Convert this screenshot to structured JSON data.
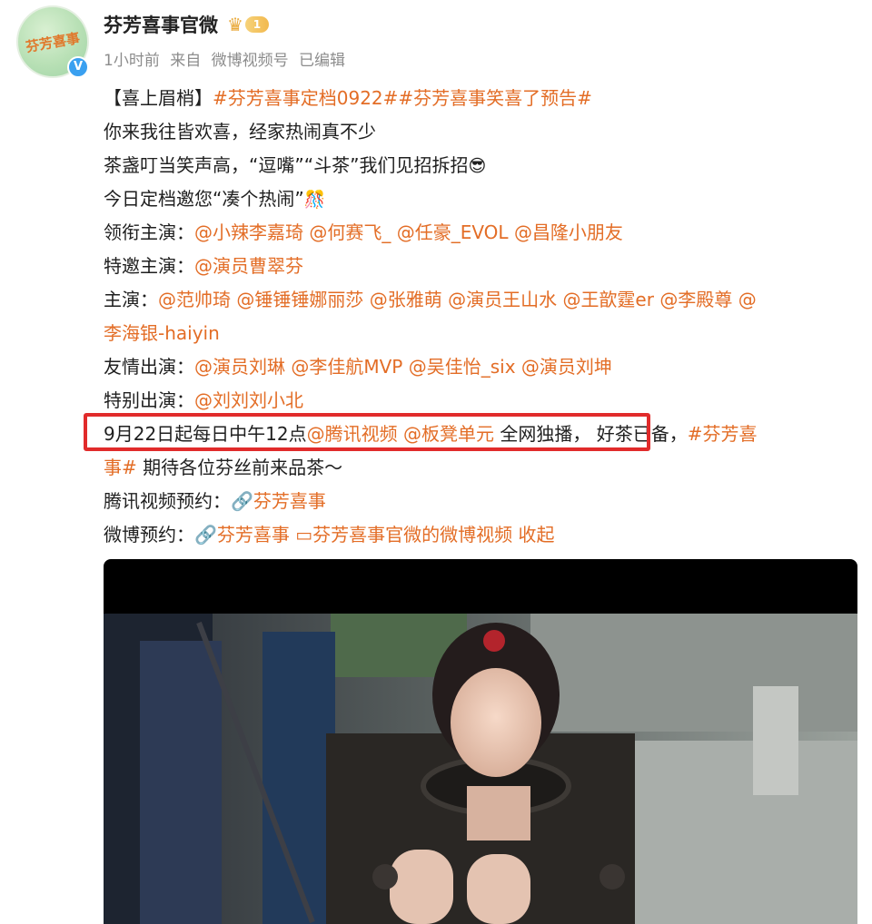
{
  "header": {
    "avatar_text": "芬芳喜事",
    "account_name": "芬芳喜事官微",
    "level_badge": "1",
    "verified_mark": "V",
    "meta": [
      "1小时前",
      "来自",
      "微博视频号",
      "已编辑"
    ]
  },
  "post": {
    "line1": {
      "prefix": "【喜上眉梢】",
      "tag1": "#芬芳喜事定档0922#",
      "tag2": "#芬芳喜事笑喜了预告#"
    },
    "line2": "你来我往皆欢喜，经家热闹真不少",
    "line3": {
      "text": "茶盏叮当笑声高，“逗嘴”“斗茶”我们见招拆招",
      "emoji": "😎"
    },
    "line4": {
      "text": "今日定档邀您“凑个热闹”",
      "emoji": "🎊"
    },
    "lead_actors": {
      "label": "领衔主演：",
      "mentions": [
        "@小辣李嘉琦",
        "@何赛飞_",
        "@任豪_EVOL",
        "@昌隆小朋友"
      ]
    },
    "special_guest": {
      "label": "特邀主演：",
      "mentions": [
        "@演员曹翠芬"
      ]
    },
    "main_cast": {
      "label": "主演：",
      "mentions": [
        "@范帅琦",
        "@锤锤锤娜丽莎",
        "@张雅萌",
        "@演员王山水",
        "@王歆霆er",
        "@李殿尊",
        "@"
      ],
      "cont": "李海银-haiyin"
    },
    "friendship": {
      "label": "友情出演：",
      "mentions": [
        "@演员刘琳",
        "@李佳航MVP",
        "@吴佳怡_six",
        "@演员刘坤"
      ]
    },
    "special_appear": {
      "label": "特别出演：",
      "mentions": [
        "@刘刘刘小北"
      ]
    },
    "schedule": {
      "prefix": "9月22日起每日中午12点",
      "at1": "@腾讯视频",
      "at2": "@板凳单元",
      "exclusive": " 全网独播，",
      "rest": " 好茶已备，",
      "tag": "#芬芳喜",
      "tag_cont": "事#",
      "end": " 期待各位芬丝前来品茶～"
    },
    "tencent": {
      "label": "腾讯视频预约：",
      "link": "芬芳喜事"
    },
    "weibo": {
      "label": "微博预约：",
      "link": "芬芳喜事",
      "video_link": "芬芳喜事官微的微博视频",
      "collapse": "收起"
    }
  },
  "colors": {
    "accent": "#e36d26",
    "highlight_border": "#e12b2b",
    "meta": "#8c8c8c"
  },
  "icons": [
    "verified-badge-icon",
    "crown-icon",
    "link-icon",
    "video-link-icon"
  ]
}
